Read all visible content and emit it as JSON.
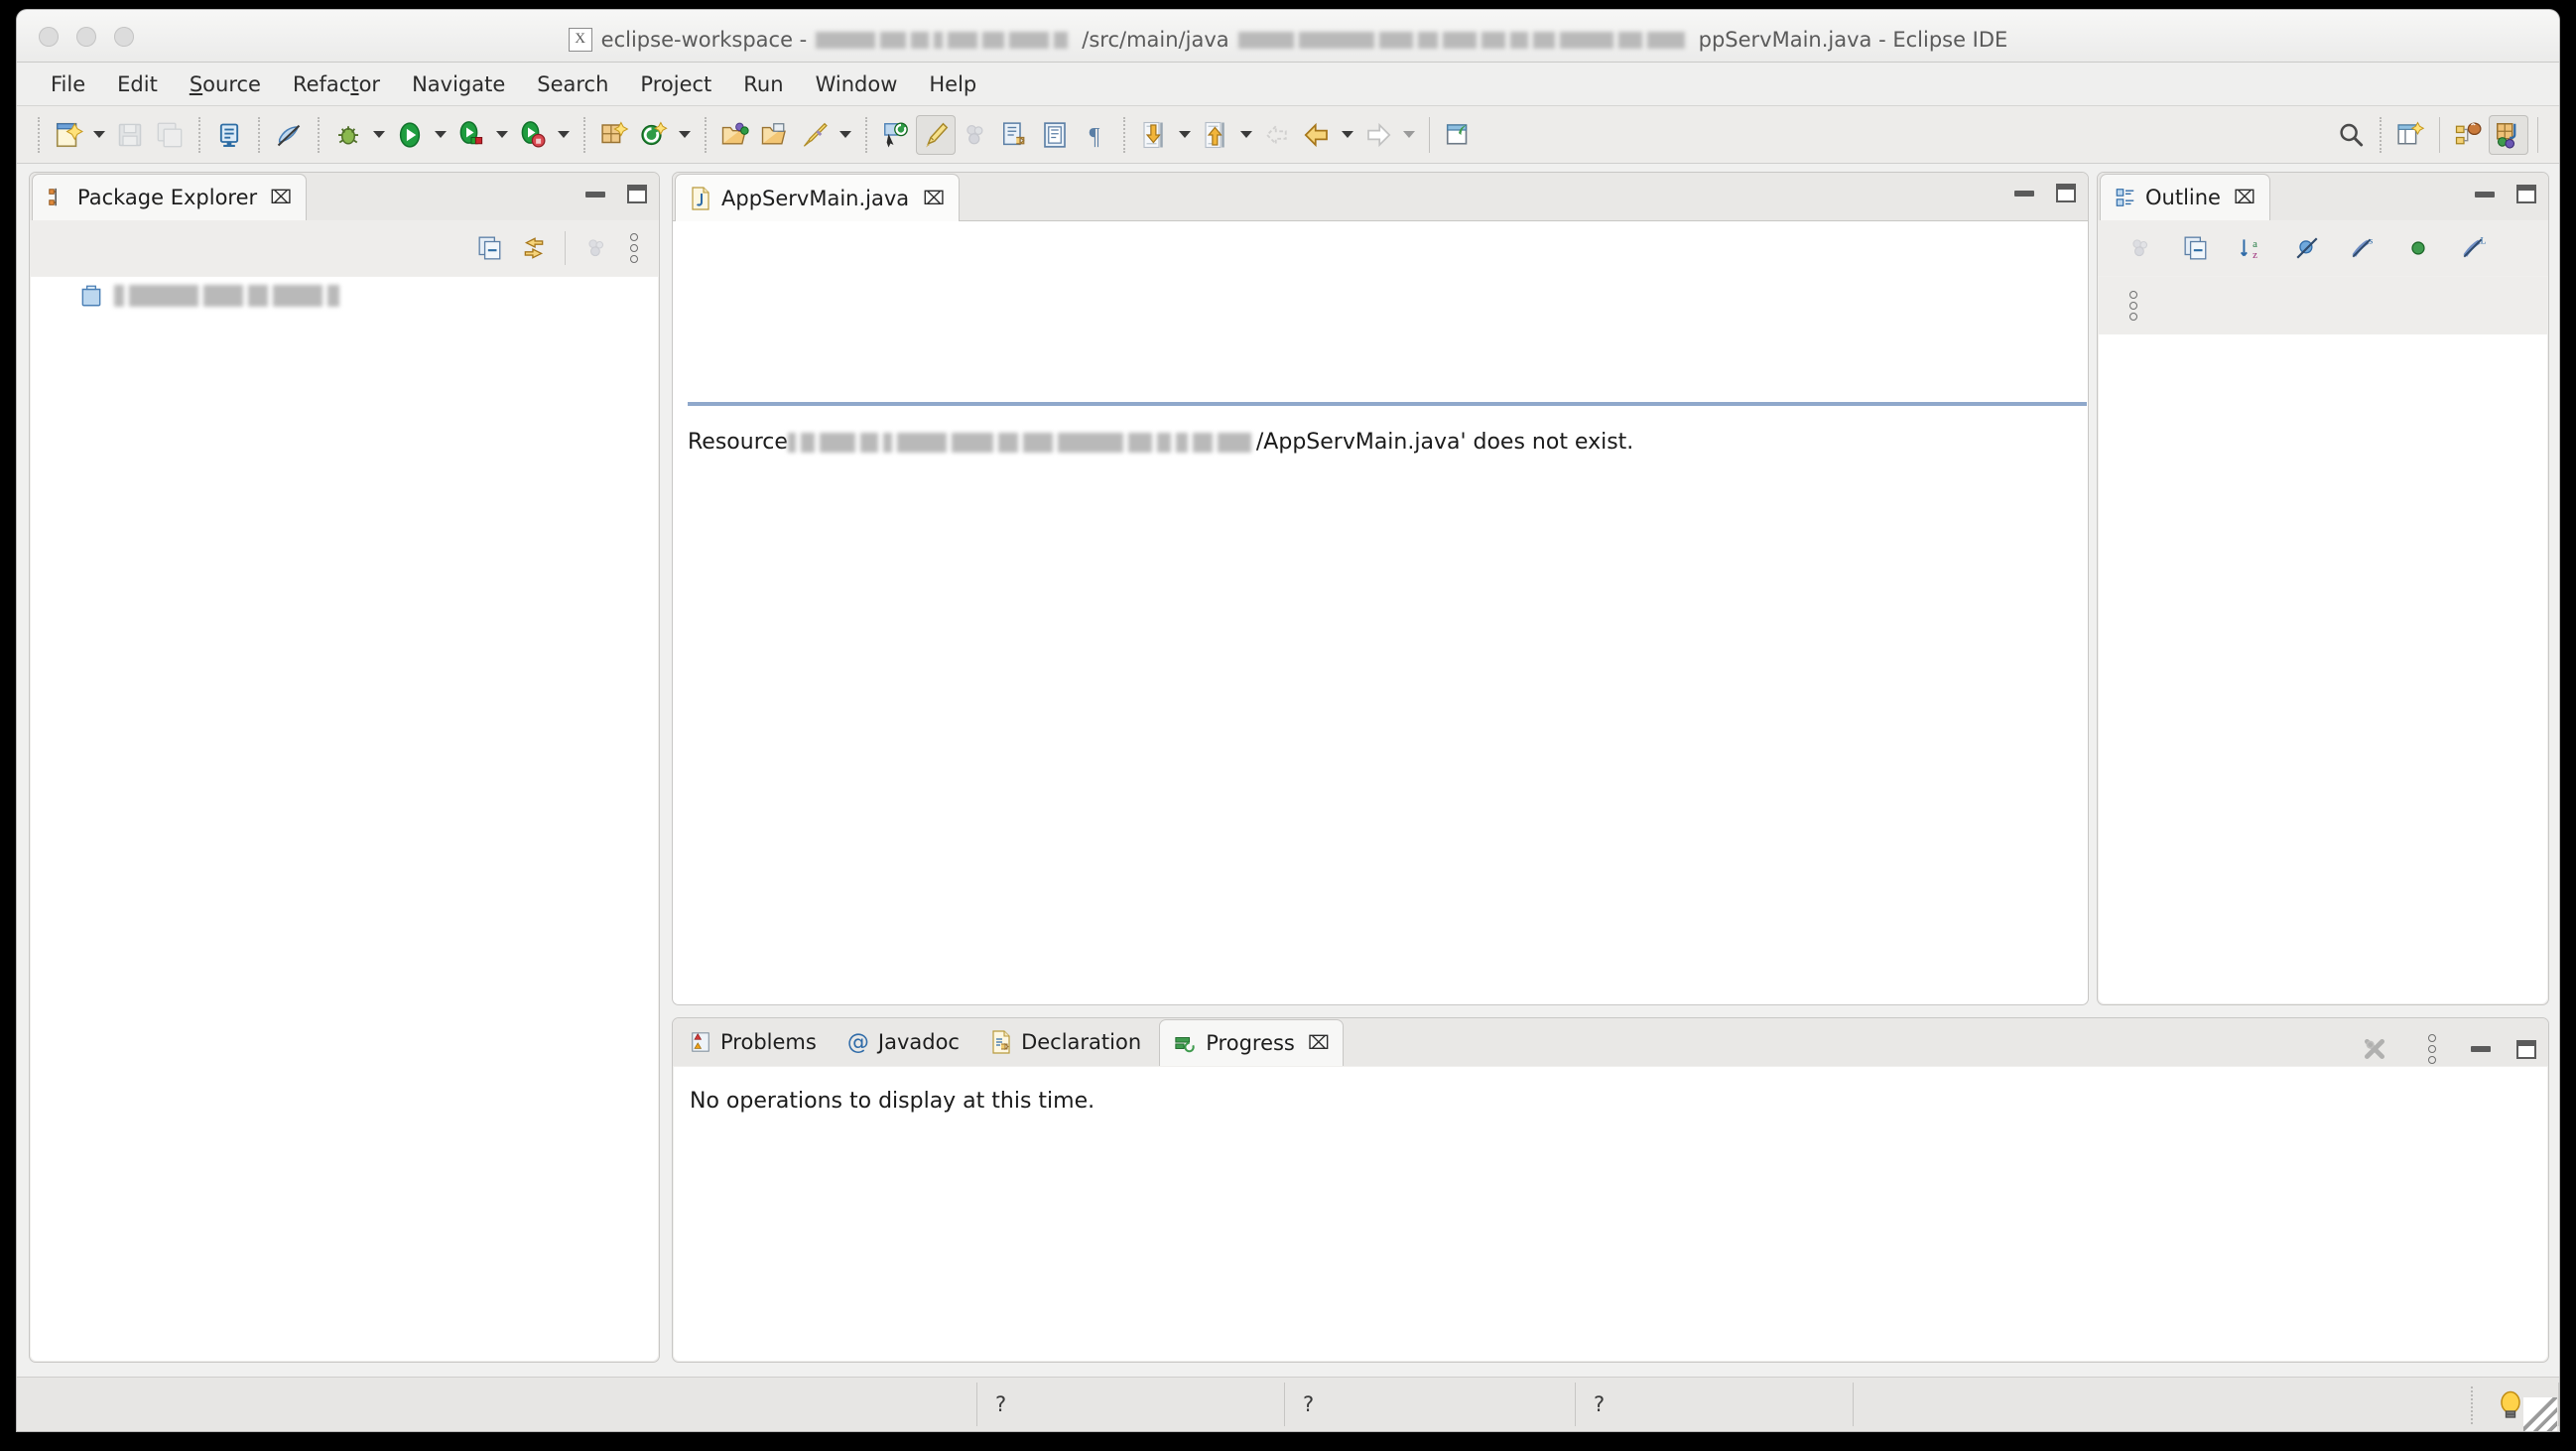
{
  "window": {
    "title_prefix": "eclipse-workspace - ",
    "title_path_visible_1": "/src/main/java",
    "title_suffix": "ppServMain.java - Eclipse IDE",
    "app_icon": "x-window-icon"
  },
  "menubar": {
    "items": [
      {
        "label": "File",
        "mnemonic": ""
      },
      {
        "label": "Edit",
        "mnemonic": ""
      },
      {
        "label": "Source",
        "mnemonic": "S"
      },
      {
        "label": "Refactor",
        "mnemonic": "t"
      },
      {
        "label": "Navigate",
        "mnemonic": ""
      },
      {
        "label": "Search",
        "mnemonic": ""
      },
      {
        "label": "Project",
        "mnemonic": ""
      },
      {
        "label": "Run",
        "mnemonic": ""
      },
      {
        "label": "Window",
        "mnemonic": ""
      },
      {
        "label": "Help",
        "mnemonic": ""
      }
    ]
  },
  "toolbar": {
    "buttons": [
      "new-wizard-icon",
      "save-icon",
      "save-all-icon",
      "print-screen-icon",
      "toggle-mark-occurrences-icon",
      "debug-icon",
      "run-icon",
      "coverage-icon",
      "external-tools-icon",
      "new-java-package-icon",
      "new-java-class-icon",
      "open-type-icon",
      "open-task-icon",
      "search-ref-icon",
      "next-annotation-icon",
      "previous-annotation-icon",
      "last-edit-location-icon",
      "back-icon",
      "forward-icon",
      "new-window-icon",
      "search-icon",
      "open-perspective-icon",
      "java-ee-perspective-icon",
      "java-perspective-icon"
    ]
  },
  "package_explorer": {
    "tab_label": "Package Explorer",
    "tab_icon": "package-explorer-icon",
    "close_glyph": "⌧",
    "toolbar_icons": [
      "collapse-all-icon",
      "link-with-editor-icon",
      "view-menu-disabled-icon",
      "view-menu-icon"
    ],
    "tree": [
      {
        "label": "",
        "icon": "project-folder-icon",
        "redacted": true
      }
    ]
  },
  "editor": {
    "tab_label": "AppServMain.java",
    "tab_icon": "java-file-icon",
    "close_glyph": "⌧",
    "minimize_icon": "minimize-icon",
    "maximize_icon": "maximize-icon",
    "message_prefix": "Resource ",
    "message_suffix": "/AppServMain.java' does not exist."
  },
  "outline": {
    "tab_label": "Outline",
    "tab_icon": "outline-icon",
    "close_glyph": "⌧",
    "toolbar_icons": [
      "focus-on-active-task-icon",
      "collapse-all-icon",
      "sort-alphabetically-icon",
      "hide-fields-icon",
      "hide-static-icon",
      "hide-non-public-icon",
      "hide-local-types-icon"
    ],
    "menu_icon": "view-menu-icon"
  },
  "bottom_panel": {
    "tabs": [
      {
        "label": "Problems",
        "icon": "problems-icon",
        "active": false,
        "closable": false
      },
      {
        "label": "Javadoc",
        "icon": "javadoc-at-icon",
        "active": false,
        "closable": false
      },
      {
        "label": "Declaration",
        "icon": "declaration-icon",
        "active": false,
        "closable": false
      },
      {
        "label": "Progress",
        "icon": "progress-icon",
        "active": true,
        "closable": true
      }
    ],
    "close_glyph": "⌧",
    "toolbar_icons": [
      "stop-all-disabled-icon",
      "view-menu-icon"
    ],
    "minimize_icon": "minimize-icon",
    "maximize_icon": "maximize-icon",
    "content_text": "No operations to display at this time."
  },
  "statusbar": {
    "cells": [
      "?",
      "?",
      "?",
      ""
    ],
    "tip_icon": "smart-tip-icon",
    "resize_grip": "resize-grip"
  },
  "colors": {
    "window_bg": "#f0f0ef",
    "toolbar_bg": "#edecea",
    "editor_rule": "#8fa8cb",
    "panel_border": "#c8c7c5",
    "text": "#1d1d1d"
  }
}
